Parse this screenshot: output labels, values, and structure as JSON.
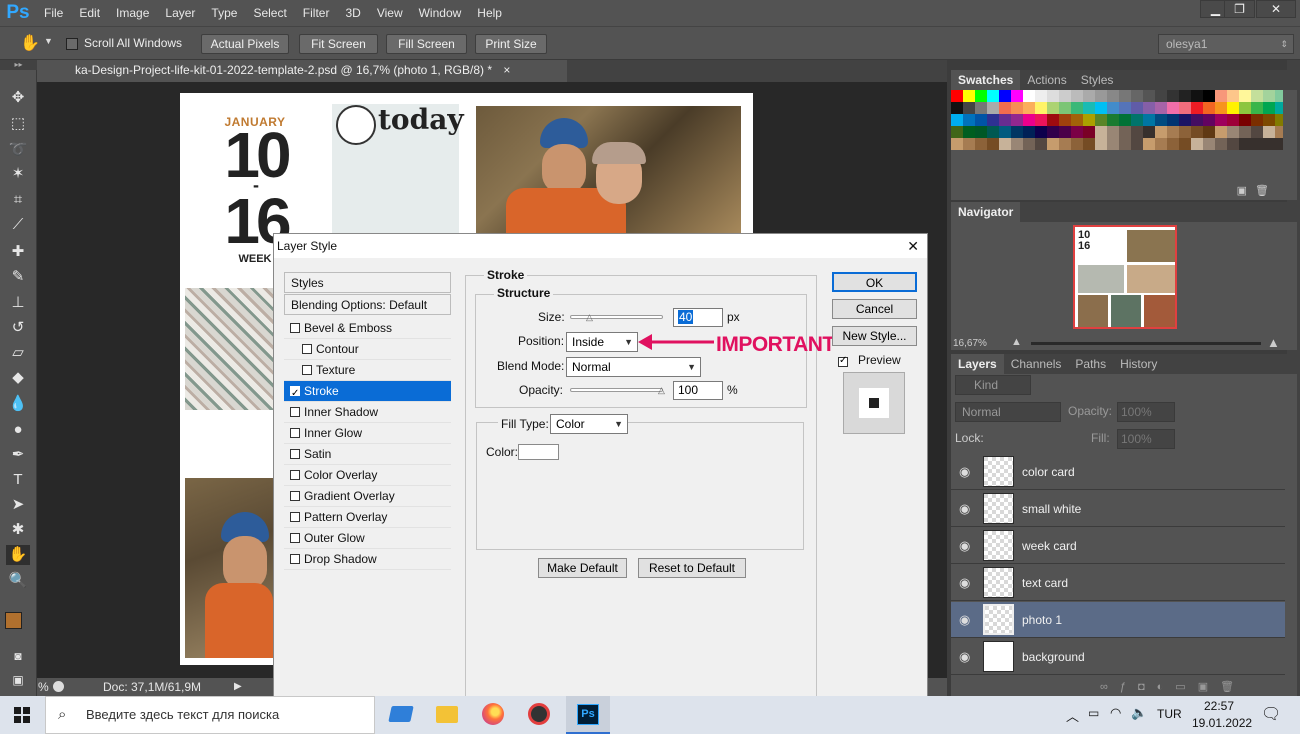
{
  "app": {
    "logo": "Ps"
  },
  "menu": [
    "File",
    "Edit",
    "Image",
    "Layer",
    "Type",
    "Select",
    "Filter",
    "3D",
    "View",
    "Window",
    "Help"
  ],
  "window_controls": [
    "▁",
    "❐",
    "✕"
  ],
  "options_bar": {
    "scroll_all_windows": "Scroll All Windows",
    "actual_pixels": "Actual Pixels",
    "fit_screen": "Fit Screen",
    "fill_screen": "Fill Screen",
    "print_size": "Print Size",
    "workspace": "olesya1"
  },
  "document": {
    "tab_title": "ka-Design-Project-life-kit-01-2022-template-2.psd @ 16,7% (photo 1, RGB/8) *",
    "tab_close": "×",
    "status_zoom": "%",
    "status_doc": "Doc: 37,1M/61,9M",
    "status_arrow": "▶"
  },
  "canvas_art": {
    "month": "JANUARY",
    "date_top": "10",
    "date_dash": "-",
    "date_bottom": "16",
    "week": "WEEK",
    "today": "today"
  },
  "panels": {
    "swatches_tabs": [
      "Swatches",
      "Actions",
      "Styles"
    ],
    "navigator_title": "Navigator",
    "navigator_zoom": "16,67%",
    "navigator_thumb_text": "10\n16",
    "layers_tabs": [
      "Layers",
      "Channels",
      "Paths",
      "History"
    ],
    "kind_filter": "Kind",
    "blend_mode": "Normal",
    "opacity_label": "Opacity:",
    "opacity_value": "100%",
    "lock_label": "Lock:",
    "fill_label": "Fill:",
    "fill_value": "100%",
    "layers": [
      "color card",
      "small white",
      "week card",
      "text card",
      "photo 1",
      "background"
    ]
  },
  "dialog": {
    "title": "Layer Style",
    "close": "✕",
    "styles_header": "Styles",
    "blending_options": "Blending Options: Default",
    "styles": [
      {
        "label": "Bevel & Emboss",
        "checked": false,
        "indent": false
      },
      {
        "label": "Contour",
        "checked": false,
        "indent": true
      },
      {
        "label": "Texture",
        "checked": false,
        "indent": true
      },
      {
        "label": "Stroke",
        "checked": true,
        "indent": false,
        "selected": true
      },
      {
        "label": "Inner Shadow",
        "checked": false,
        "indent": false
      },
      {
        "label": "Inner Glow",
        "checked": false,
        "indent": false
      },
      {
        "label": "Satin",
        "checked": false,
        "indent": false
      },
      {
        "label": "Color Overlay",
        "checked": false,
        "indent": false
      },
      {
        "label": "Gradient Overlay",
        "checked": false,
        "indent": false
      },
      {
        "label": "Pattern Overlay",
        "checked": false,
        "indent": false
      },
      {
        "label": "Outer Glow",
        "checked": false,
        "indent": false
      },
      {
        "label": "Drop Shadow",
        "checked": false,
        "indent": false
      }
    ],
    "section_title": "Stroke",
    "structure_title": "Structure",
    "size_label": "Size:",
    "size_value": "40",
    "size_unit": "px",
    "position_label": "Position:",
    "position_value": "Inside",
    "blend_mode_label": "Blend Mode:",
    "blend_mode_value": "Normal",
    "opacity_label": "Opacity:",
    "opacity_value": "100",
    "opacity_unit": "%",
    "fill_type_label": "Fill Type:",
    "fill_type_value": "Color",
    "color_label": "Color:",
    "make_default": "Make Default",
    "reset_default": "Reset to Default",
    "ok": "OK",
    "cancel": "Cancel",
    "new_style": "New Style...",
    "preview": "Preview",
    "annotation": "IMPORTANT",
    "annotation_color": "#e0115f"
  },
  "taskbar": {
    "search_placeholder": "Введите здесь текст для поиска",
    "language": "TUR",
    "time": "22:57",
    "date": "19.01.2022"
  }
}
